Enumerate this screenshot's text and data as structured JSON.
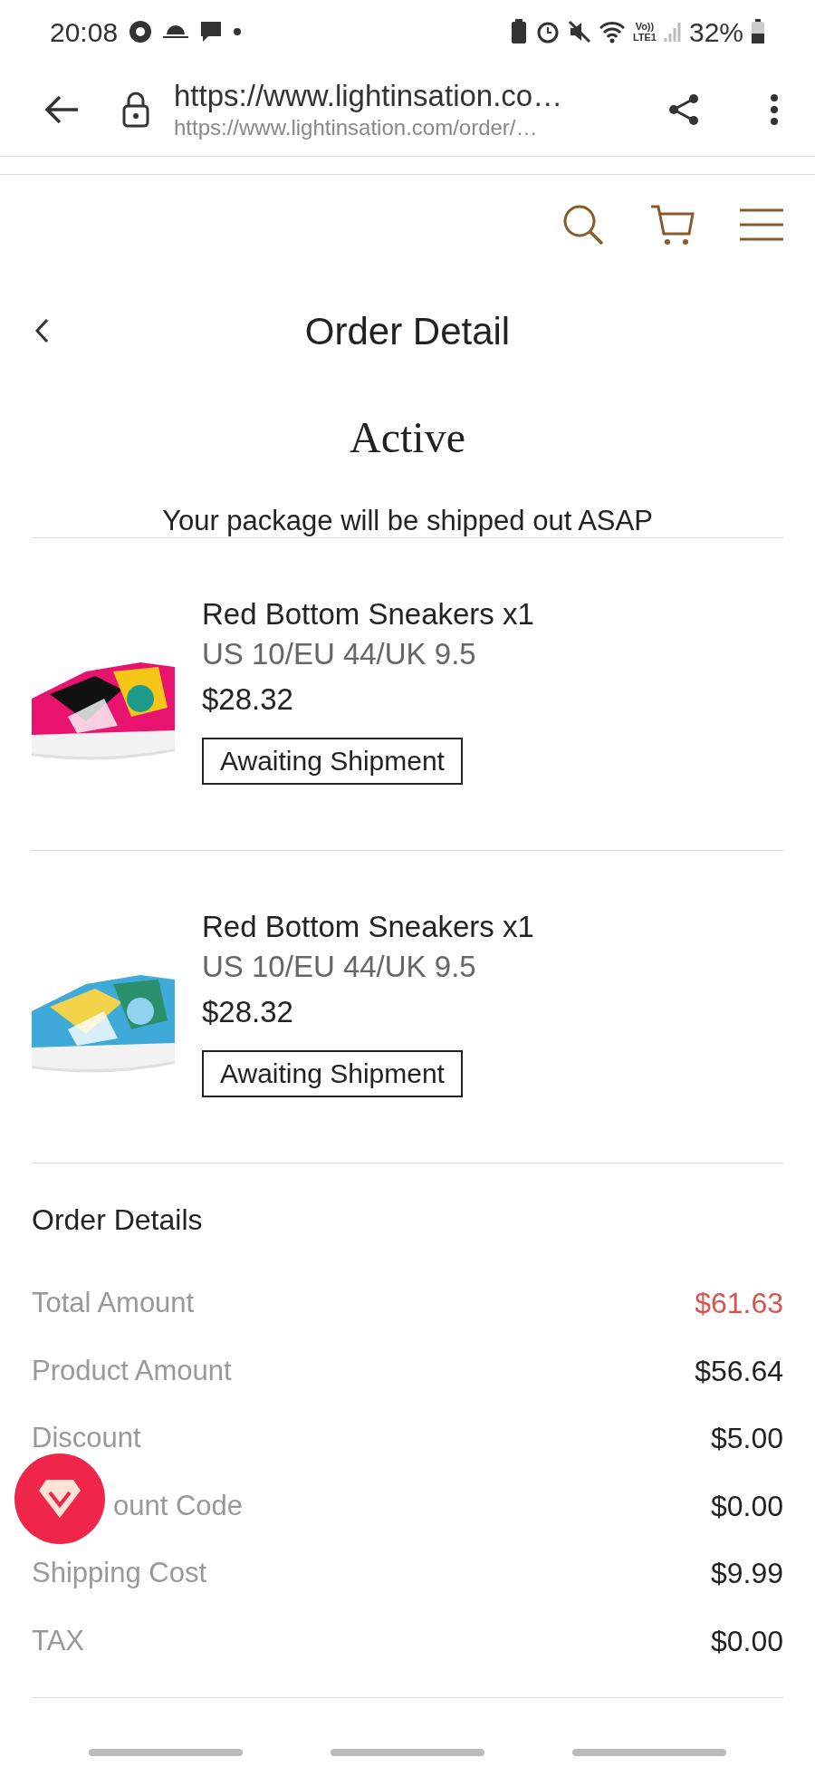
{
  "status_bar": {
    "time": "20:08",
    "network": "Vo))\nLTE1",
    "battery": "32%"
  },
  "browser": {
    "title": "https://www.lightinsation.co…",
    "url": "https://www.lightinsation.com/order/…"
  },
  "page": {
    "title": "Order Detail",
    "status": "Active",
    "message": "Your package will be shipped out ASAP"
  },
  "items": [
    {
      "name": "Red Bottom Sneakers x1",
      "variant": "US 10/EU 44/UK 9.5",
      "price": "$28.32",
      "status": "Awaiting Shipment"
    },
    {
      "name": "Red Bottom Sneakers x1",
      "variant": "US 10/EU 44/UK 9.5",
      "price": "$28.32",
      "status": "Awaiting Shipment"
    }
  ],
  "order_details": {
    "title": "Order Details",
    "rows": [
      {
        "label": "Total Amount",
        "value": "$61.63",
        "highlight": true
      },
      {
        "label": "Product Amount",
        "value": "$56.64",
        "highlight": false
      },
      {
        "label": "Discount",
        "value": "$5.00",
        "highlight": false
      },
      {
        "label": "ount Code",
        "value": "$0.00",
        "highlight": false,
        "covered": true
      },
      {
        "label": "Shipping Cost",
        "value": "$9.99",
        "highlight": false
      },
      {
        "label": "TAX",
        "value": "$0.00",
        "highlight": false
      }
    ]
  }
}
